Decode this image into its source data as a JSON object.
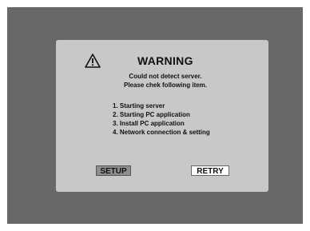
{
  "dialog": {
    "title": "WARNING",
    "icon": "warning-triangle-icon",
    "message_line1": "Could not detect server.",
    "message_line2": "Please chek following item.",
    "items": [
      "1. Starting server",
      "2. Starting PC application",
      "3. Install PC application",
      "4. Network connection & setting"
    ],
    "setup_label": "SETUP",
    "retry_label": "RETRY"
  },
  "colors": {
    "screen_background": "#686868",
    "dialog_background": "#c8c8c8",
    "selected_button": "#8e8e8e",
    "unselected_button": "#ffffff"
  }
}
